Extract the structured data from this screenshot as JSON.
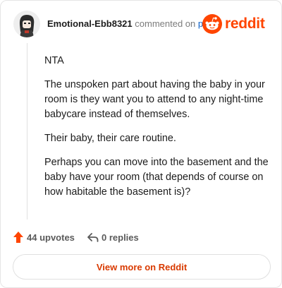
{
  "header": {
    "username": "Emotional-Ebb8321",
    "commented_text": "commented on",
    "post_link": "post",
    "brand": "reddit"
  },
  "comment": {
    "paragraphs": [
      "NTA",
      "The unspoken part about having the baby in your room is they want you to attend to any night-time babycare instead of themselves.",
      "Their baby, their care routine.",
      "Perhaps you can move into the basement and the baby have your room (that depends of course on how habitable the basement is)?"
    ]
  },
  "actions": {
    "upvotes_label": "44 upvotes",
    "replies_label": "0 replies"
  },
  "footer": {
    "view_more_label": "View more on Reddit"
  },
  "colors": {
    "brand": "#ff4500",
    "link": "#0e62c9",
    "cta": "#d93a00"
  },
  "icons": [
    "avatar",
    "reddit-logo-icon",
    "upvote-arrow-icon",
    "reply-arrow-icon"
  ]
}
